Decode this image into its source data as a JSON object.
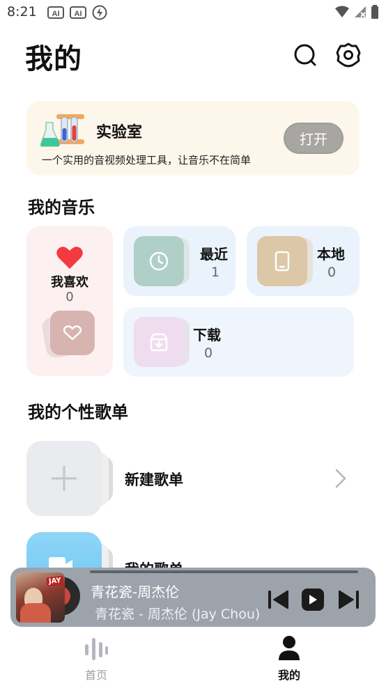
{
  "status": {
    "time": "8:21"
  },
  "header": {
    "title": "我的",
    "search_icon": "search-icon",
    "settings_icon": "settings-icon"
  },
  "lab": {
    "title": "实验室",
    "description": "一个实用的音视频处理工具，让音乐不在简单",
    "open_label": "打开"
  },
  "my_music": {
    "title": "我的音乐",
    "favorites": {
      "label": "我喜欢",
      "count": "0"
    },
    "recent": {
      "label": "最近",
      "count": "1"
    },
    "local": {
      "label": "本地",
      "count": "0"
    },
    "download": {
      "label": "下载",
      "count": "0"
    }
  },
  "playlists": {
    "title": "我的个性歌单",
    "new_label": "新建歌单",
    "mine_label": "我的歌单"
  },
  "player": {
    "title": "青花瓷-周杰伦",
    "subtitle": "青花瓷 - 周杰伦 (Jay Chou)",
    "album_label": "JAY",
    "progress": 0
  },
  "nav": {
    "home_label": "首页",
    "mine_label": "我的"
  },
  "colors": {
    "heart": "#f23a3f",
    "player_bg": "#9da3ab",
    "lab_bg": "#fdf6ea"
  }
}
